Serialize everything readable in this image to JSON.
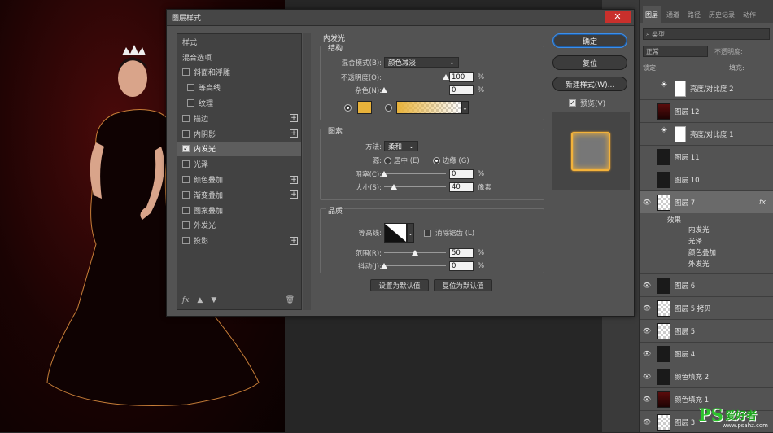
{
  "dialog": {
    "title": "图层样式",
    "close": "✕",
    "styles_list": [
      {
        "label": "样式",
        "checkbox": false,
        "plus": false
      },
      {
        "label": "混合选项",
        "checkbox": false,
        "plus": false
      },
      {
        "label": "斜面和浮雕",
        "checkbox": true,
        "checked": false,
        "plus": false
      },
      {
        "label": "等高线",
        "checkbox": true,
        "checked": false,
        "plus": false,
        "indent": true
      },
      {
        "label": "纹理",
        "checkbox": true,
        "checked": false,
        "plus": false,
        "indent": true
      },
      {
        "label": "描边",
        "checkbox": true,
        "checked": false,
        "plus": true
      },
      {
        "label": "内阴影",
        "checkbox": true,
        "checked": false,
        "plus": true
      },
      {
        "label": "内发光",
        "checkbox": true,
        "checked": true,
        "plus": false,
        "selected": true
      },
      {
        "label": "光泽",
        "checkbox": true,
        "checked": false,
        "plus": false
      },
      {
        "label": "颜色叠加",
        "checkbox": true,
        "checked": false,
        "plus": true
      },
      {
        "label": "渐变叠加",
        "checkbox": true,
        "checked": false,
        "plus": true
      },
      {
        "label": "图案叠加",
        "checkbox": true,
        "checked": false,
        "plus": false
      },
      {
        "label": "外发光",
        "checkbox": true,
        "checked": false,
        "plus": false
      },
      {
        "label": "投影",
        "checkbox": true,
        "checked": false,
        "plus": true
      }
    ],
    "bottom_fx": "fx",
    "panel": {
      "title": "内发光",
      "structure": {
        "title": "结构",
        "blend_label": "混合模式(B):",
        "blend_value": "颜色减淡",
        "opacity_label": "不透明度(O):",
        "opacity_value": "100",
        "opacity_unit": "%",
        "opacity_fraction": 1.0,
        "noise_label": "杂色(N):",
        "noise_value": "0",
        "noise_unit": "%",
        "noise_fraction": 0.0,
        "glow_color": "#e8b23a"
      },
      "elements": {
        "title": "图素",
        "method_label": "方法:",
        "method_value": "柔和",
        "source_label": "源:",
        "source_center": "居中 (E)",
        "source_edge": "边缘 (G)",
        "choke_label": "阻塞(C):",
        "choke_value": "0",
        "choke_unit": "%",
        "choke_fraction": 0.0,
        "size_label": "大小(S):",
        "size_value": "40",
        "size_unit": "像素",
        "size_fraction": 0.16
      },
      "quality": {
        "title": "品质",
        "contour_label": "等高线:",
        "antialias_label": "消除锯齿 (L)",
        "range_label": "范围(R):",
        "range_value": "50",
        "range_unit": "%",
        "range_fraction": 0.5,
        "jitter_label": "抖动(J):",
        "jitter_value": "0",
        "jitter_unit": "%",
        "jitter_fraction": 0.0
      },
      "set_default": "设置为默认值",
      "reset_default": "复位为默认值"
    },
    "buttons": {
      "ok": "确定",
      "reset": "复位",
      "new_style": "新建样式(W)...",
      "preview_label": "预览(V)"
    }
  },
  "layers_panel": {
    "tabs": [
      "图层",
      "通道",
      "路径",
      "历史记录",
      "动作"
    ],
    "filter_label": "类型",
    "blend_mode": "正常",
    "opacity_label": "不透明度:",
    "lock_label": "锁定:",
    "fill_label": "填充:",
    "layers": [
      {
        "name": "亮度/对比度 2",
        "visible": false,
        "thumb": "adjust"
      },
      {
        "name": "图层 12",
        "visible": false,
        "thumb": "red"
      },
      {
        "name": "亮度/对比度 1",
        "visible": false,
        "thumb": "adjust"
      },
      {
        "name": "图层 11",
        "visible": false,
        "thumb": "dark"
      },
      {
        "name": "图层 10",
        "visible": false,
        "thumb": "dark"
      },
      {
        "name": "图层 7",
        "visible": true,
        "thumb": "check",
        "selected": true,
        "fx": "fx"
      },
      {
        "name": "图层 6",
        "visible": true,
        "thumb": "dark"
      },
      {
        "name": "图层 5 拷贝",
        "visible": true,
        "thumb": "check"
      },
      {
        "name": "图层 5",
        "visible": true,
        "thumb": "check"
      },
      {
        "name": "图层 4",
        "visible": true,
        "thumb": "dark"
      },
      {
        "name": "颜色填充 2",
        "visible": true,
        "thumb": "dark"
      },
      {
        "name": "颜色填充 1",
        "visible": true,
        "thumb": "red"
      },
      {
        "name": "图层 3",
        "visible": true,
        "thumb": "check"
      }
    ],
    "effects": {
      "label": "效果",
      "items": [
        "内发光",
        "光泽",
        "颜色叠加",
        "外发光"
      ]
    }
  },
  "watermark": {
    "ps": "PS",
    "cn": "爱好者",
    "url": "www.psahz.com"
  },
  "colors": {
    "accent": "#3d8ee8",
    "glow": "#f3b23a"
  }
}
